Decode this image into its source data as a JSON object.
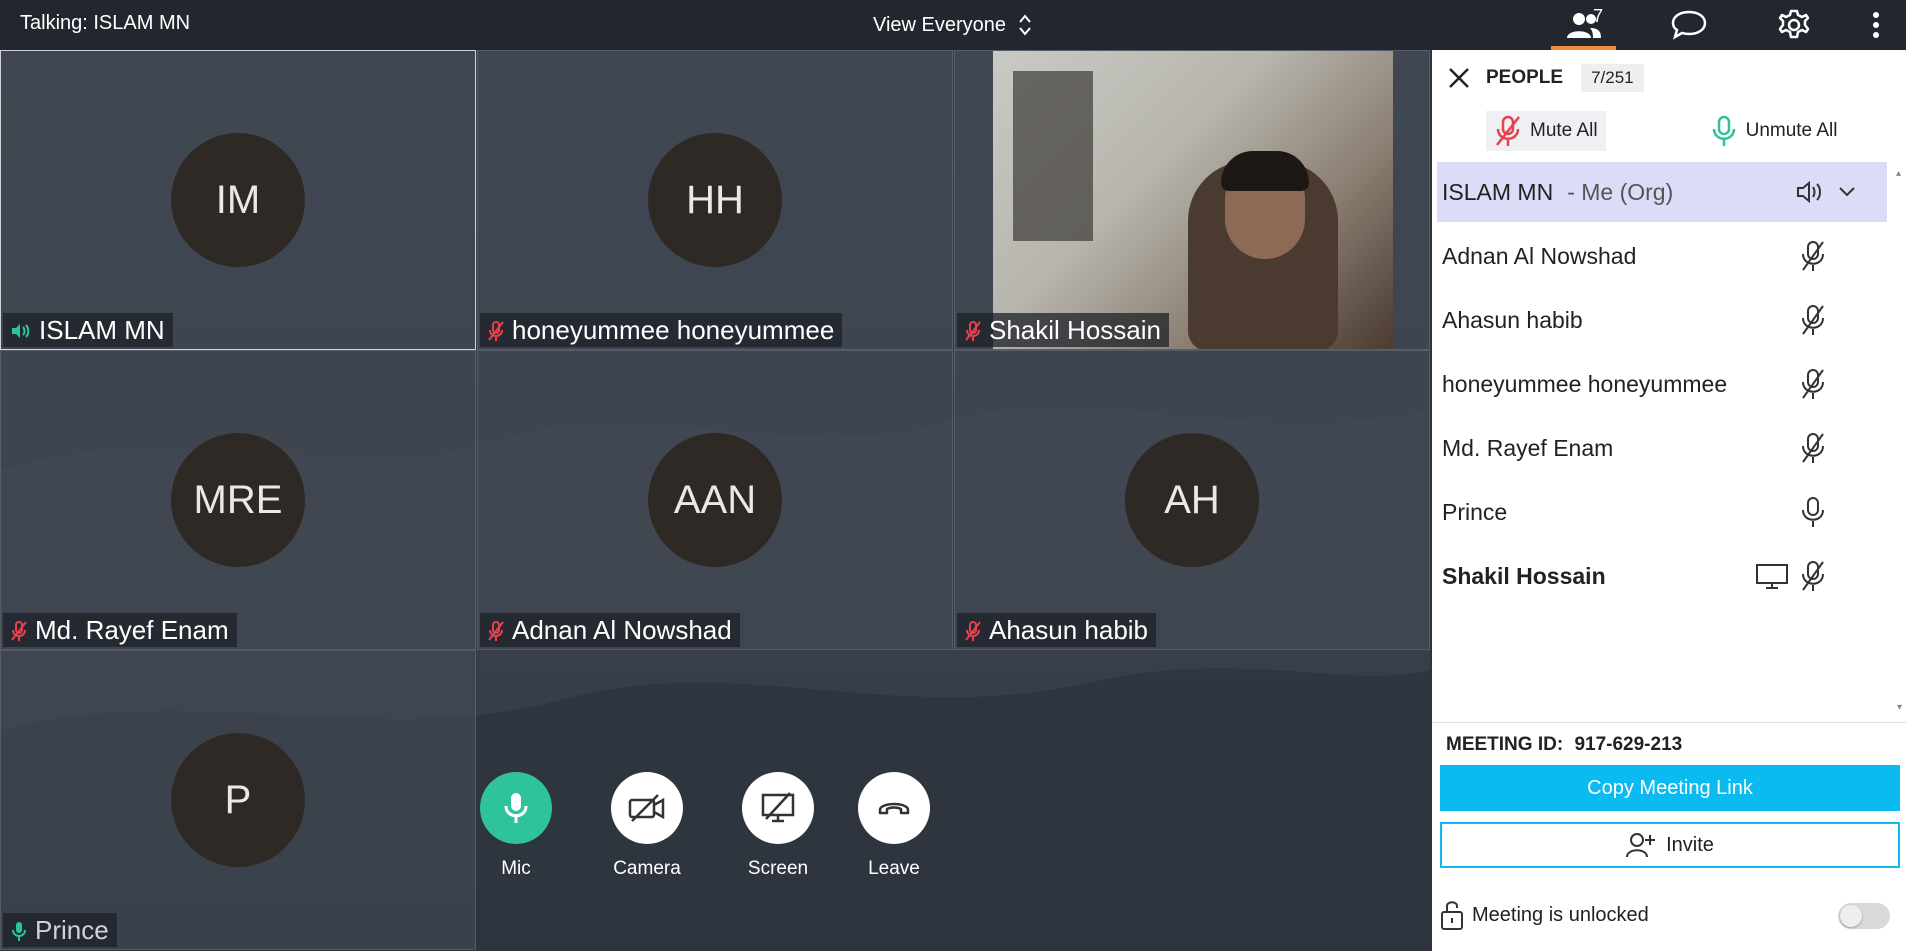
{
  "topbar": {
    "talking": "Talking: ISLAM MN",
    "view_label": "View Everyone",
    "people_count": "7"
  },
  "tiles": [
    {
      "initials": "IM",
      "name": "ISLAM MN",
      "audio": "speaking"
    },
    {
      "initials": "HH",
      "name": "honeyummee honeyummee",
      "audio": "muted"
    },
    {
      "initials": "",
      "name": "Shakil Hossain",
      "audio": "muted",
      "video": true
    },
    {
      "initials": "MRE",
      "name": "Md. Rayef Enam",
      "audio": "muted"
    },
    {
      "initials": "AAN",
      "name": "Adnan Al Nowshad",
      "audio": "muted"
    },
    {
      "initials": "AH",
      "name": "Ahasun habib",
      "audio": "muted"
    },
    {
      "initials": "P",
      "name": "Prince",
      "audio": "unmuted"
    }
  ],
  "controls": {
    "mic": "Mic",
    "camera": "Camera",
    "screen": "Screen",
    "leave": "Leave"
  },
  "sidebar": {
    "title": "PEOPLE",
    "count": "7/251",
    "mute_all": "Mute All",
    "unmute_all": "Unmute All",
    "me_suffix": "- Me (Org)",
    "people": [
      {
        "name": "ISLAM MN",
        "status": "speaking",
        "me": true
      },
      {
        "name": "Adnan Al Nowshad",
        "status": "muted"
      },
      {
        "name": "Ahasun habib",
        "status": "muted"
      },
      {
        "name": "honeyummee honeyummee",
        "status": "muted"
      },
      {
        "name": "Md. Rayef Enam",
        "status": "muted"
      },
      {
        "name": "Prince",
        "status": "unmuted"
      },
      {
        "name": "Shakil Hossain",
        "status": "muted",
        "sharing": true,
        "bold": true
      }
    ],
    "meeting_id_label": "MEETING ID:",
    "meeting_id": "917-629-213",
    "copy_link": "Copy Meeting Link",
    "invite": "Invite",
    "lock_status": "Meeting is unlocked"
  },
  "colors": {
    "accent": "#0abaf0",
    "mic_green": "#2fc39b",
    "muted_red": "#e8404f",
    "active_tab": "#f08a3c"
  }
}
